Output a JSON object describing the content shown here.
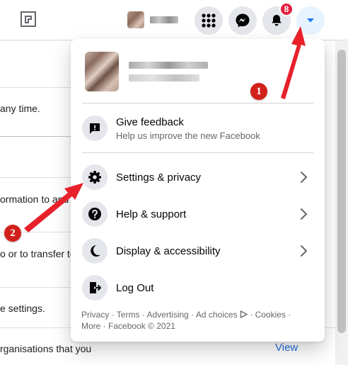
{
  "header": {
    "notification_count": "8"
  },
  "background": {
    "lines": [
      "any time.",
      "ormation to and",
      "o or to transfer to",
      "e settings.",
      "rganisations that you"
    ],
    "view_link": "View"
  },
  "menu": {
    "items": [
      {
        "label": "Give feedback",
        "sub": "Help us improve the new Facebook",
        "icon": "feedback-icon"
      },
      {
        "label": "Settings & privacy",
        "icon": "gear-icon"
      },
      {
        "label": "Help & support",
        "icon": "question-icon"
      },
      {
        "label": "Display & accessibility",
        "icon": "moon-icon"
      },
      {
        "label": "Log Out",
        "icon": "logout-icon"
      }
    ],
    "footer": {
      "privacy": "Privacy",
      "terms": "Terms",
      "advertising": "Advertising",
      "ad_choices": "Ad choices",
      "cookies": "Cookies",
      "more": "More",
      "copyright": "Facebook © 2021",
      "sep": " · "
    }
  },
  "annotations": {
    "step1": "1",
    "step2": "2",
    "color": "#e8202a"
  },
  "colors": {
    "accent": "#1877f2",
    "badge": "#e41e3f",
    "annotation": "#e8202a"
  }
}
